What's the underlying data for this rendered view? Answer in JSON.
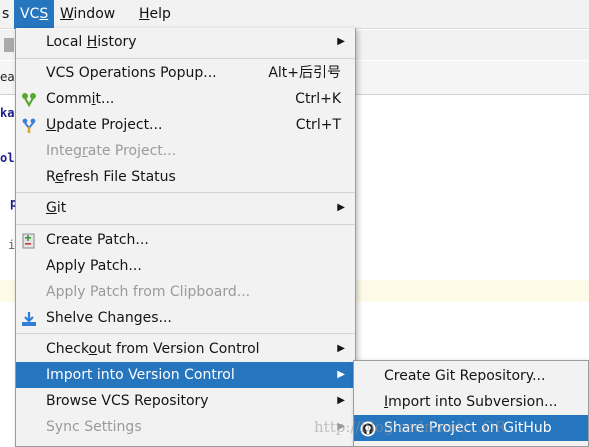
{
  "menubar": {
    "items": [
      {
        "pre": "",
        "mn": "",
        "post": "s"
      },
      {
        "pre": "VC",
        "mn": "S",
        "post": ""
      },
      {
        "pre": "",
        "mn": "W",
        "post": "indow"
      },
      {
        "pre": "",
        "mn": "H",
        "post": "elp"
      }
    ]
  },
  "editor": {
    "tab_text": "ea",
    "code_fragments": [
      "ka",
      "oli",
      "p",
      "i"
    ]
  },
  "vcs_menu": {
    "local_history": {
      "pre": "Local ",
      "mn": "H",
      "post": "istory"
    },
    "operations_popup": {
      "label": "VCS Operations Popup...",
      "shortcut": "Alt+后引号"
    },
    "commit": {
      "pre": "Comm",
      "mn": "i",
      "post": "t...",
      "shortcut": "Ctrl+K"
    },
    "update_project": {
      "pre": "",
      "mn": "U",
      "post": "pdate Project...",
      "shortcut": "Ctrl+T"
    },
    "integrate_project": {
      "pre": "Integ",
      "mn": "r",
      "post": "ate Project..."
    },
    "refresh_status": {
      "pre": "R",
      "mn": "e",
      "post": "fresh File Status"
    },
    "git": {
      "pre": "",
      "mn": "G",
      "post": "it"
    },
    "create_patch": {
      "label": "Create Patch..."
    },
    "apply_patch": {
      "label": "Apply Patch..."
    },
    "apply_patch_clipboard": {
      "label": "Apply Patch from Clipboard..."
    },
    "shelve_changes": {
      "label": "Shelve Changes..."
    },
    "checkout": {
      "pre": "Check",
      "mn": "o",
      "post": "ut from Version Control"
    },
    "import_vc": {
      "label": "Import into Version Control"
    },
    "browse_repo": {
      "label": "Browse VCS Repository"
    },
    "sync_settings": {
      "label": "Sync Settings"
    },
    "submenu_arrow": "▶"
  },
  "import_submenu": {
    "create_git_repo": {
      "label": "Create Git Repository..."
    },
    "import_subversion": {
      "pre": "",
      "mn": "I",
      "post": "mport into Subversion..."
    },
    "share_github": {
      "label": "Share Project on GitHub"
    }
  },
  "watermark": {
    "text": "http://blog.csdn.net/...OR"
  },
  "colors": {
    "selection": "#2675bf",
    "menu_bg": "#f2f2f2",
    "disabled_text": "#9a9a9a",
    "editor_highlight": "#fdfbe8"
  },
  "icons": [
    "commit-icon",
    "update-project-icon",
    "create-patch-icon",
    "shelve-changes-icon",
    "github-icon",
    "chevron-right-icon"
  ]
}
